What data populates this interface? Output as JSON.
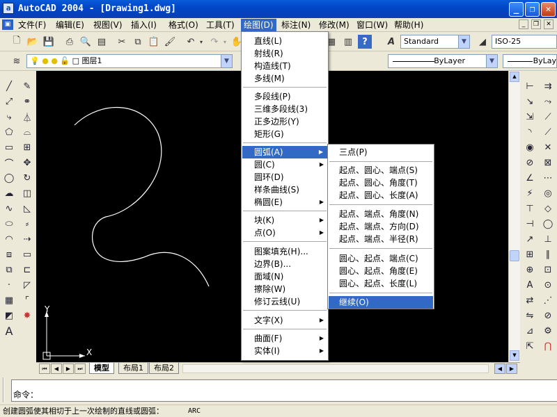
{
  "window": {
    "title": "AutoCAD 2004 - [Drawing1.dwg]",
    "app_icon": "a"
  },
  "menubar": {
    "items": [
      "文件(F)",
      "编辑(E)",
      "视图(V)",
      "插入(I)",
      "格式(O)",
      "工具(T)",
      "绘图(D)",
      "标注(N)",
      "修改(M)",
      "窗口(W)",
      "帮助(H)"
    ]
  },
  "toolbar": {
    "text_style": "Standard",
    "dim_style": "ISO-25",
    "layer": "图层1",
    "linetype": "ByLayer",
    "lineweight": "ByLay"
  },
  "draw_menu": {
    "items": [
      "直线(L)",
      "射线(R)",
      "构造线(T)",
      "多线(M)",
      "多段线(P)",
      "三维多段线(3)",
      "正多边形(Y)",
      "矩形(G)",
      "圆弧(A)",
      "圆(C)",
      "圆环(D)",
      "样条曲线(S)",
      "椭圆(E)",
      "块(K)",
      "点(O)",
      "图案填充(H)...",
      "边界(B)...",
      "面域(N)",
      "擦除(W)",
      "修订云线(U)",
      "文字(X)",
      "曲面(F)",
      "实体(I)"
    ]
  },
  "arc_menu": {
    "items": [
      "三点(P)",
      "起点、圆心、端点(S)",
      "起点、圆心、角度(T)",
      "起点、圆心、长度(A)",
      "起点、端点、角度(N)",
      "起点、端点、方向(D)",
      "起点、端点、半径(R)",
      "圆心、起点、端点(C)",
      "圆心、起点、角度(E)",
      "圆心、起点、长度(L)",
      "继续(O)"
    ]
  },
  "ucs": {
    "x_label": "X",
    "y_label": "Y"
  },
  "layout_tabs": [
    "模型",
    "布局1",
    "布局2"
  ],
  "command": {
    "prompt": "命令："
  },
  "status": {
    "help_text": "创建圆弧使其相切于上一次绘制的直线或圆弧：",
    "command_name": "ARC"
  },
  "colors": {
    "canvas_bg": "#000000",
    "menu_highlight": "#316ac5",
    "titlebar": "#0046c8"
  }
}
